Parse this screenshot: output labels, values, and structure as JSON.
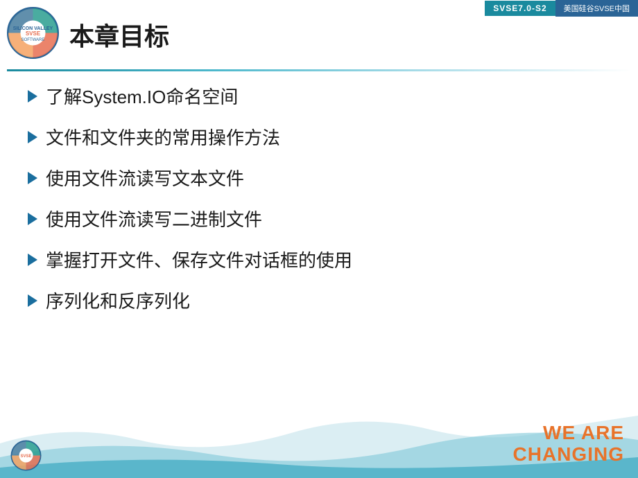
{
  "header": {
    "title": "本章目标",
    "badge_svse": "SVSE7.0-S2",
    "badge_china": "美国硅谷SVSE中国"
  },
  "bullets": [
    {
      "text": "了解System.IO命名空间"
    },
    {
      "text": "文件和文件夹的常用操作方法"
    },
    {
      "text": "使用文件流读写文本文件"
    },
    {
      "text": "使用文件流读写二进制文件"
    },
    {
      "text": "掌握打开文件、保存文件对话框的使用"
    },
    {
      "text": "序列化和反序列化"
    }
  ],
  "footer": {
    "slogan_line1": "WE ARE",
    "slogan_line2": "CHANGING"
  }
}
